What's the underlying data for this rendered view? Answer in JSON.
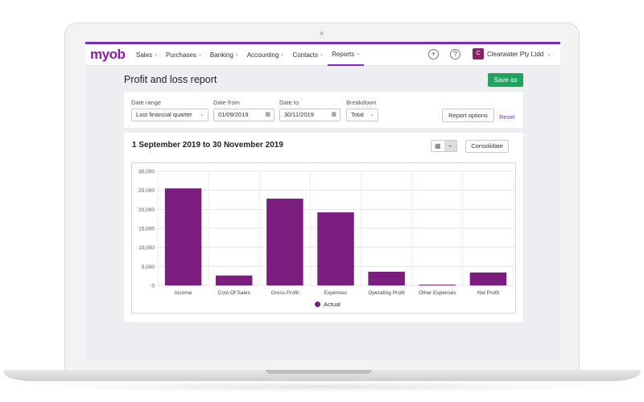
{
  "nav": {
    "logo": "myob",
    "items": [
      {
        "label": "Sales",
        "active": false
      },
      {
        "label": "Purchases",
        "active": false
      },
      {
        "label": "Banking",
        "active": false
      },
      {
        "label": "Accounting",
        "active": false
      },
      {
        "label": "Contacts",
        "active": false
      },
      {
        "label": "Reports",
        "active": true
      }
    ],
    "company": {
      "avatar": "C",
      "name": "Clearwater Pty Ltdd"
    }
  },
  "page": {
    "title": "Profit and loss report",
    "save_label": "Save as"
  },
  "filters": {
    "date_range_label": "Date range",
    "date_range_value": "Last financial quarter",
    "date_from_label": "Date from",
    "date_from_value": "01/09/2019",
    "date_to_label": "Date to",
    "date_to_value": "30/11/2019",
    "breakdown_label": "Breakdown",
    "breakdown_value": "Total",
    "report_options_label": "Report options",
    "reset_label": "Reset"
  },
  "report": {
    "heading": "1 September 2019 to 30 November 2019",
    "consolidate_label": "Consolidate"
  },
  "colors": {
    "accent": "#7b2cbf",
    "bar": "#7a1d7e",
    "save": "#1fa35f"
  },
  "chart_data": {
    "type": "bar",
    "categories": [
      "Income",
      "Cost Of Sales",
      "Gross Profit",
      "Expenses",
      "Operating Profit",
      "Other Expenses",
      "Net Profit"
    ],
    "series": [
      {
        "name": "Actual",
        "values": [
          25500,
          2600,
          22800,
          19200,
          3600,
          200,
          3400
        ]
      }
    ],
    "ylim": [
      0,
      30000
    ],
    "yticks": [
      0,
      5000,
      10000,
      15000,
      20000,
      25000,
      30000
    ],
    "ytick_labels": [
      "0",
      "5,000",
      "10,000",
      "15,000",
      "20,000",
      "25,000",
      "30,000"
    ],
    "grid": true,
    "legend": "bottom-center"
  }
}
